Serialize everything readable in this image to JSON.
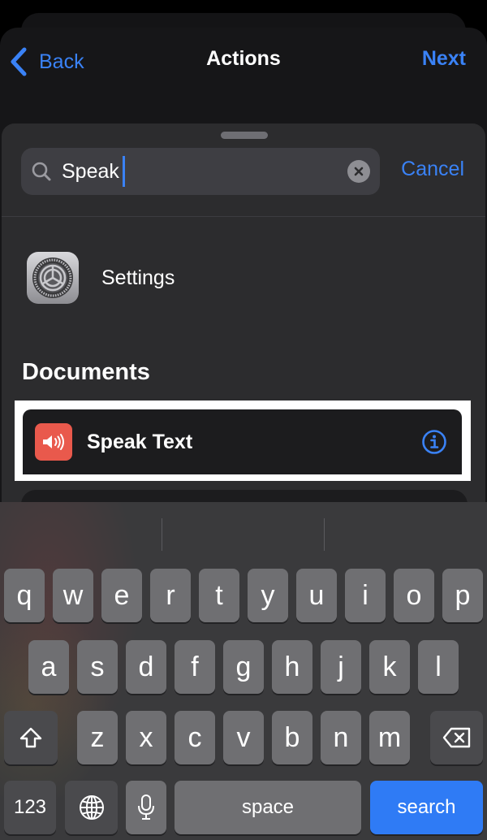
{
  "nav": {
    "back_label": "Back",
    "title": "Actions",
    "next_label": "Next"
  },
  "search": {
    "value": "Speak",
    "cancel_label": "Cancel"
  },
  "results": {
    "app_result": {
      "label": "Settings",
      "icon": "settings-gear-icon"
    },
    "section_header": "Documents",
    "actions": [
      {
        "label": "Speak Text",
        "icon": "speaker-icon",
        "icon_color": "#e9594c",
        "highlighted": true
      }
    ]
  },
  "keyboard": {
    "row1": [
      "q",
      "w",
      "e",
      "r",
      "t",
      "y",
      "u",
      "i",
      "o",
      "p"
    ],
    "row2": [
      "a",
      "s",
      "d",
      "f",
      "g",
      "h",
      "j",
      "k",
      "l"
    ],
    "row3": [
      "z",
      "x",
      "c",
      "v",
      "b",
      "n",
      "m"
    ],
    "numbers_label": "123",
    "space_label": "space",
    "search_label": "search"
  },
  "colors": {
    "accent": "#3a82f6",
    "search_key": "#2f7bf5"
  }
}
